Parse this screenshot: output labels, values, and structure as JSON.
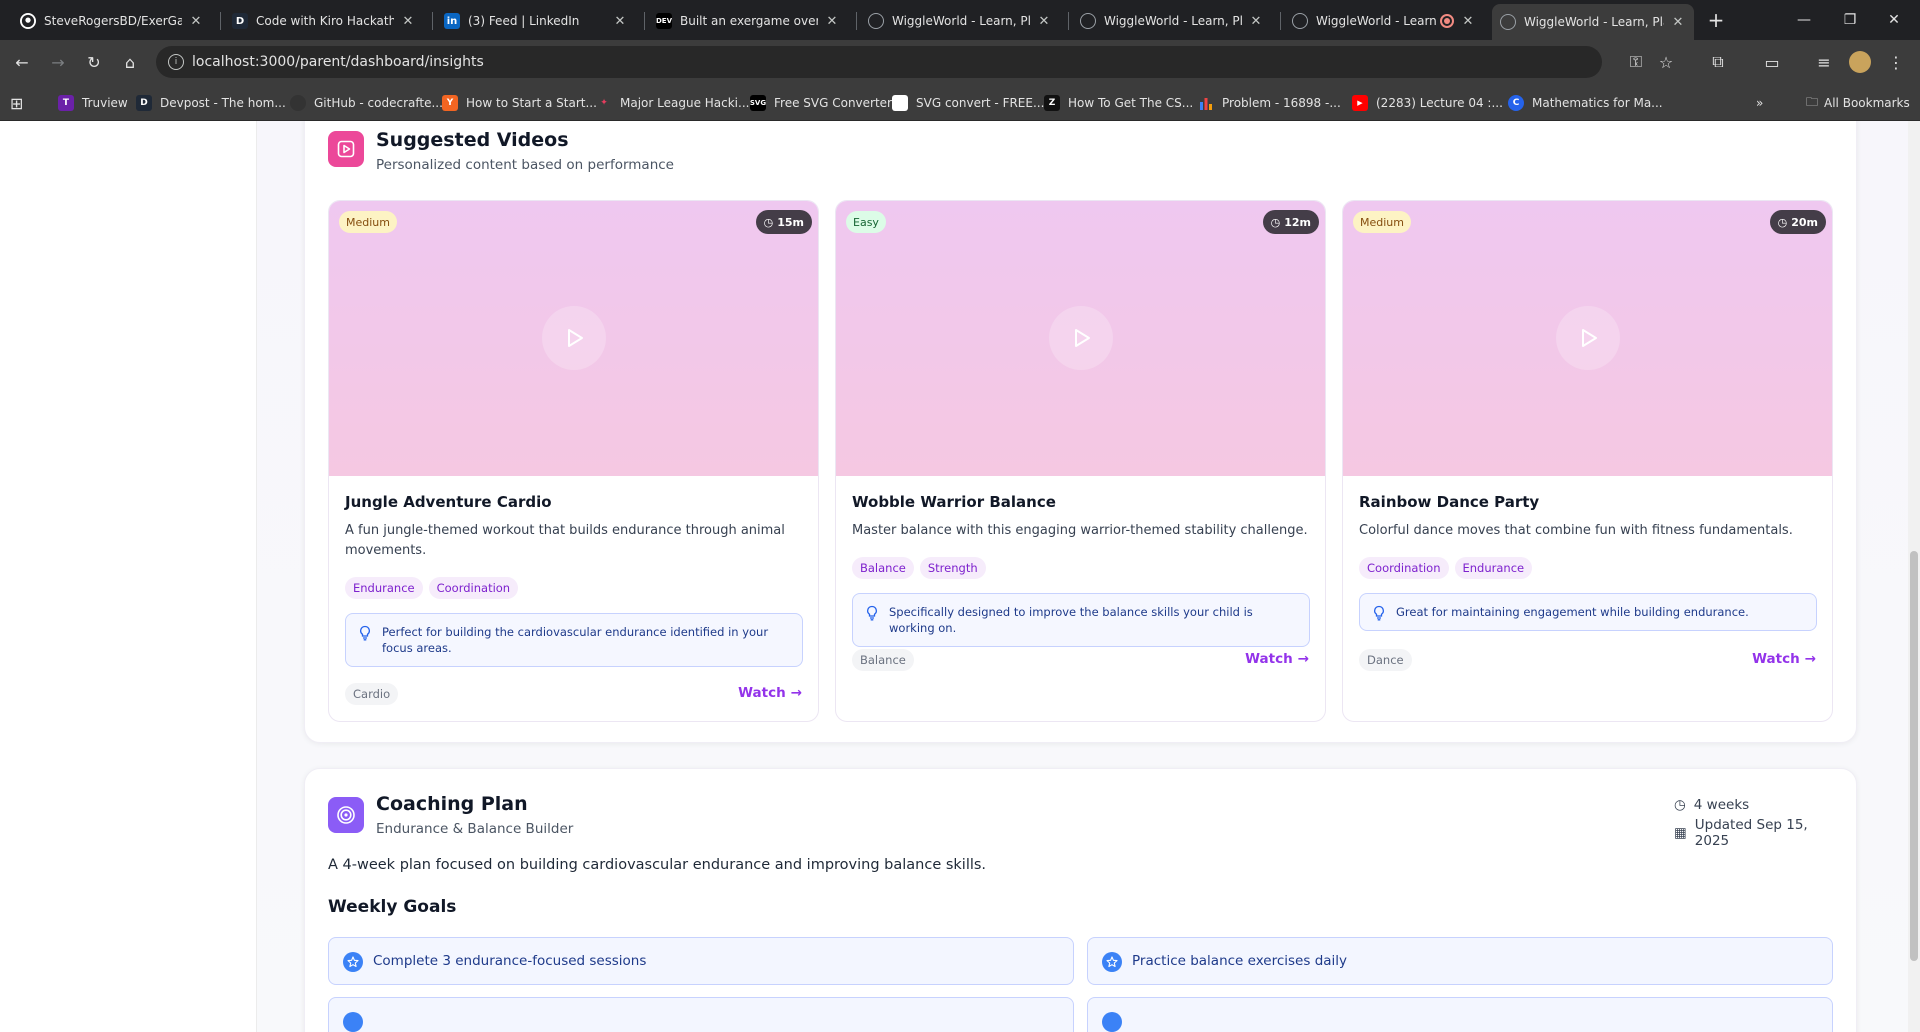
{
  "browser": {
    "tabs": [
      {
        "title": "SteveRogersBD/ExerGame"
      },
      {
        "title": "Code with Kiro Hackathon"
      },
      {
        "title": "(3) Feed | LinkedIn"
      },
      {
        "title": "Built an exergame over the"
      },
      {
        "title": "WiggleWorld - Learn, Play"
      },
      {
        "title": "WiggleWorld - Learn, Play"
      },
      {
        "title": "WiggleWorld - Learn, F"
      },
      {
        "title": "WiggleWorld - Learn, Play"
      }
    ],
    "url": "localhost:3000/parent/dashboard/insights",
    "bookmarks": [
      {
        "label": "Truview"
      },
      {
        "label": "Devpost - The hom..."
      },
      {
        "label": "GitHub - codecrafte..."
      },
      {
        "label": "How to Start a Start..."
      },
      {
        "label": "Major League Hacki..."
      },
      {
        "label": "Free SVG Converter"
      },
      {
        "label": "SVG convert - FREE..."
      },
      {
        "label": "How To Get The CS..."
      },
      {
        "label": "Problem - 16898 -..."
      },
      {
        "label": "(2283) Lecture 04 :..."
      },
      {
        "label": "Mathematics for Ma..."
      }
    ],
    "all_bookmarks": "All Bookmarks"
  },
  "suggested": {
    "title": "Suggested Videos",
    "subtitle": "Personalized content based on performance",
    "videos": [
      {
        "difficulty": "Medium",
        "duration": "15m",
        "title": "Jungle Adventure Cardio",
        "description": "A fun jungle-themed workout that builds endurance through animal movements.",
        "tags": [
          "Endurance",
          "Coordination"
        ],
        "tip": "Perfect for building the cardiovascular endurance identified in your focus areas.",
        "category": "Cardio",
        "watch": "Watch"
      },
      {
        "difficulty": "Easy",
        "duration": "12m",
        "title": "Wobble Warrior Balance",
        "description": "Master balance with this engaging warrior-themed stability challenge.",
        "tags": [
          "Balance",
          "Strength"
        ],
        "tip": "Specifically designed to improve the balance skills your child is working on.",
        "category": "Balance",
        "watch": "Watch"
      },
      {
        "difficulty": "Medium",
        "duration": "20m",
        "title": "Rainbow Dance Party",
        "description": "Colorful dance moves that combine fun with fitness fundamentals.",
        "tags": [
          "Coordination",
          "Endurance"
        ],
        "tip": "Great for maintaining engagement while building endurance.",
        "category": "Dance",
        "watch": "Watch"
      }
    ]
  },
  "coaching": {
    "title": "Coaching Plan",
    "subtitle": "Endurance & Balance Builder",
    "duration": "4 weeks",
    "updated": "Updated Sep 15, 2025",
    "description": "A 4-week plan focused on building cardiovascular endurance and improving balance skills.",
    "weekly_goals_title": "Weekly Goals",
    "goals": [
      "Complete 3 endurance-focused sessions",
      "Practice balance exercises daily"
    ]
  },
  "colors": {
    "accent": "#9333ea",
    "pink_icon": "#ec4899",
    "purple_icon": "#8b5cf6",
    "medium_badge": "#fdf3c4",
    "easy_badge": "#dcfce7"
  }
}
